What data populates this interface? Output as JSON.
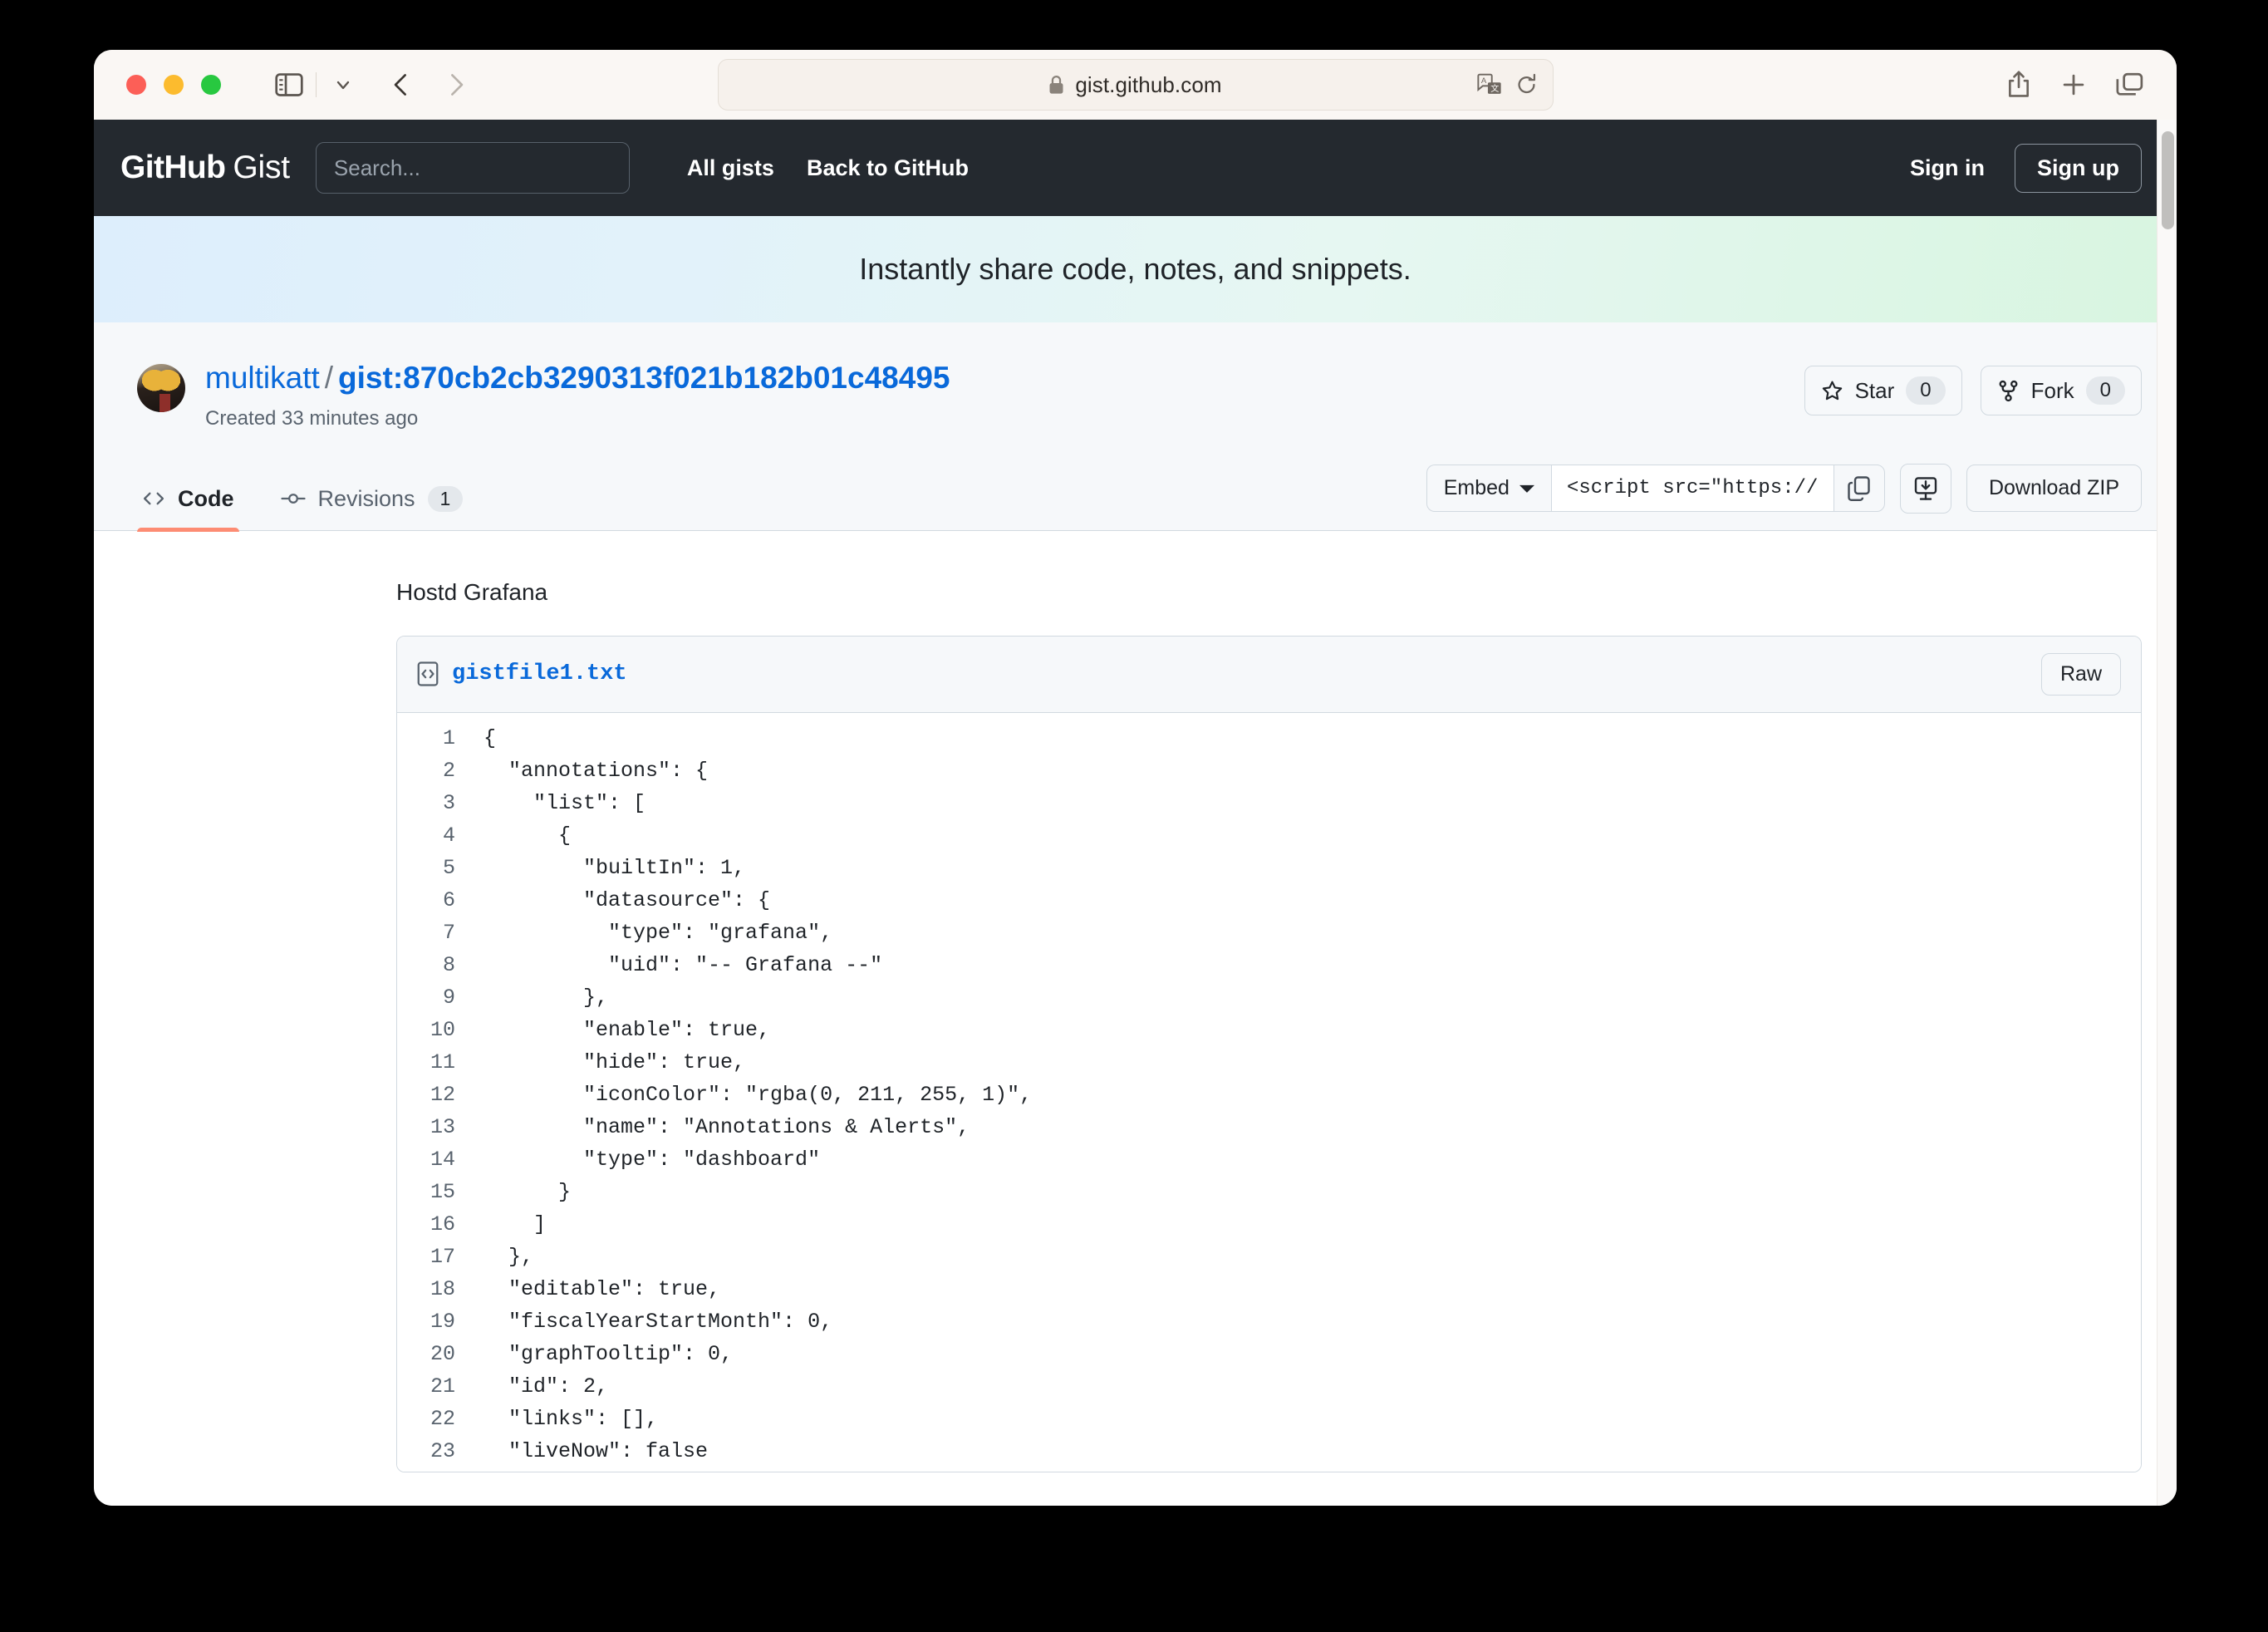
{
  "browser": {
    "url": "gist.github.com",
    "icons": {
      "sidebar": "sidebar-icon",
      "chevron": "chevron-down-icon",
      "back": "back-arrow-icon",
      "forward": "forward-arrow-icon",
      "lock": "lock-icon",
      "translate": "translate-icon",
      "reload": "reload-icon",
      "share": "share-icon",
      "new_tab": "plus-icon",
      "tab_overview": "tab-overview-icon"
    }
  },
  "header": {
    "logo_bold": "GitHub",
    "logo_light": "Gist",
    "search_placeholder": "Search...",
    "search_value": "",
    "nav": [
      {
        "label": "All gists"
      },
      {
        "label": "Back to GitHub"
      }
    ],
    "sign_in": "Sign in",
    "sign_up": "Sign up"
  },
  "hero": {
    "tagline": "Instantly share code, notes, and snippets."
  },
  "gist": {
    "owner": "multikatt",
    "separator": "/",
    "name": "gist:870cb2cb3290313f021b182b01c48495",
    "created": "Created 33 minutes ago",
    "star_label": "Star",
    "star_count": "0",
    "fork_label": "Fork",
    "fork_count": "0"
  },
  "tabs": [
    {
      "label": "Code",
      "icon": "code-icon",
      "active": true
    },
    {
      "label": "Revisions",
      "icon": "revisions-icon",
      "badge": "1",
      "active": false
    }
  ],
  "toolbar": {
    "embed_label": "Embed",
    "embed_value": "<script src=\"https://",
    "copy_icon": "copy-icon",
    "download_icon": "desktop-download-icon",
    "download_zip": "Download ZIP"
  },
  "file": {
    "description": "Hostd Grafana",
    "filename": "gistfile1.txt",
    "raw_label": "Raw",
    "lines": [
      {
        "n": "1",
        "t": "{"
      },
      {
        "n": "2",
        "t": "  \"annotations\": {"
      },
      {
        "n": "3",
        "t": "    \"list\": ["
      },
      {
        "n": "4",
        "t": "      {"
      },
      {
        "n": "5",
        "t": "        \"builtIn\": 1,"
      },
      {
        "n": "6",
        "t": "        \"datasource\": {"
      },
      {
        "n": "7",
        "t": "          \"type\": \"grafana\","
      },
      {
        "n": "8",
        "t": "          \"uid\": \"-- Grafana --\""
      },
      {
        "n": "9",
        "t": "        },"
      },
      {
        "n": "10",
        "t": "        \"enable\": true,"
      },
      {
        "n": "11",
        "t": "        \"hide\": true,"
      },
      {
        "n": "12",
        "t": "        \"iconColor\": \"rgba(0, 211, 255, 1)\","
      },
      {
        "n": "13",
        "t": "        \"name\": \"Annotations & Alerts\","
      },
      {
        "n": "14",
        "t": "        \"type\": \"dashboard\""
      },
      {
        "n": "15",
        "t": "      }"
      },
      {
        "n": "16",
        "t": "    ]"
      },
      {
        "n": "17",
        "t": "  },"
      },
      {
        "n": "18",
        "t": "  \"editable\": true,"
      },
      {
        "n": "19",
        "t": "  \"fiscalYearStartMonth\": 0,"
      },
      {
        "n": "20",
        "t": "  \"graphTooltip\": 0,"
      },
      {
        "n": "21",
        "t": "  \"id\": 2,"
      },
      {
        "n": "22",
        "t": "  \"links\": [],"
      },
      {
        "n": "23",
        "t": "  \"liveNow\": false"
      }
    ]
  },
  "colors": {
    "header_bg": "#24292f",
    "link": "#0969da",
    "active_tab_underline": "#fd8c73",
    "page_bg": "#f6f8fa"
  }
}
